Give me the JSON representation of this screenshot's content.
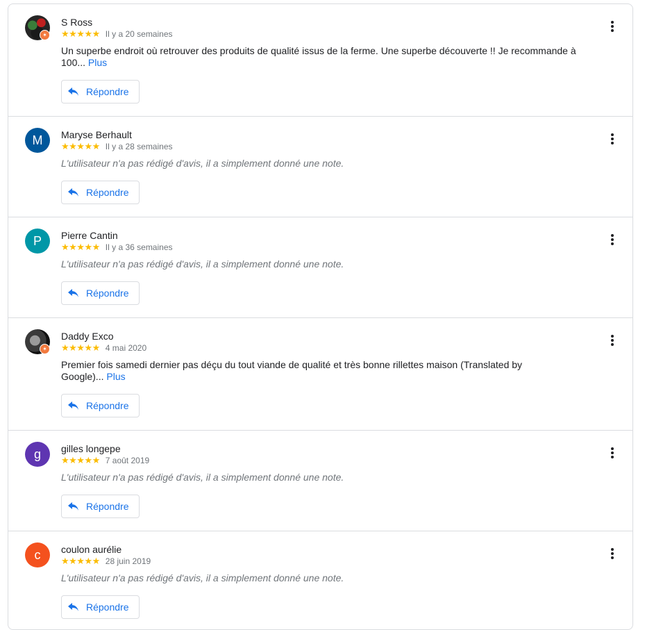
{
  "reviews": [
    {
      "name": "S Ross",
      "avatar_letter": "",
      "avatar_style": "photo1",
      "local_guide": true,
      "stars": "★★★★★",
      "date": "Il y a 20 semaines",
      "text": "Un superbe endroit où retrouver des produits de qualité issus de la ferme. Une superbe découverte !! Je recommande à 100...",
      "more": "Plus",
      "reply": "Répondre"
    },
    {
      "name": "Maryse Berhault",
      "avatar_letter": "M",
      "avatar_color": "#00579b",
      "stars": "★★★★★",
      "date": "Il y a 28 semaines",
      "note": "L'utilisateur n'a pas rédigé d'avis, il a simplement donné une note.",
      "reply": "Répondre"
    },
    {
      "name": "Pierre Cantin",
      "avatar_letter": "P",
      "avatar_color": "#0097a7",
      "stars": "★★★★★",
      "date": "Il y a 36 semaines",
      "note": "L'utilisateur n'a pas rédigé d'avis, il a simplement donné une note.",
      "reply": "Répondre"
    },
    {
      "name": "Daddy Exco",
      "avatar_letter": "",
      "avatar_style": "photo2",
      "local_guide": true,
      "stars": "★★★★★",
      "date": "4 mai 2020",
      "text": "Premier fois samedi dernier pas déçu du tout viande de qualité et très bonne rillettes maison (Translated by Google)...",
      "more": "Plus",
      "reply": "Répondre"
    },
    {
      "name": "gilles longepe",
      "avatar_letter": "g",
      "avatar_color": "#5e35b1",
      "stars": "★★★★★",
      "date": "7 août 2019",
      "note": "L'utilisateur n'a pas rédigé d'avis, il a simplement donné une note.",
      "reply": "Répondre"
    },
    {
      "name": "coulon aurélie",
      "avatar_letter": "c",
      "avatar_color": "#f4511e",
      "stars": "★★★★★",
      "date": "28 juin 2019",
      "note": "L'utilisateur n'a pas rédigé d'avis, il a simplement donné une note.",
      "reply": "Répondre"
    }
  ]
}
